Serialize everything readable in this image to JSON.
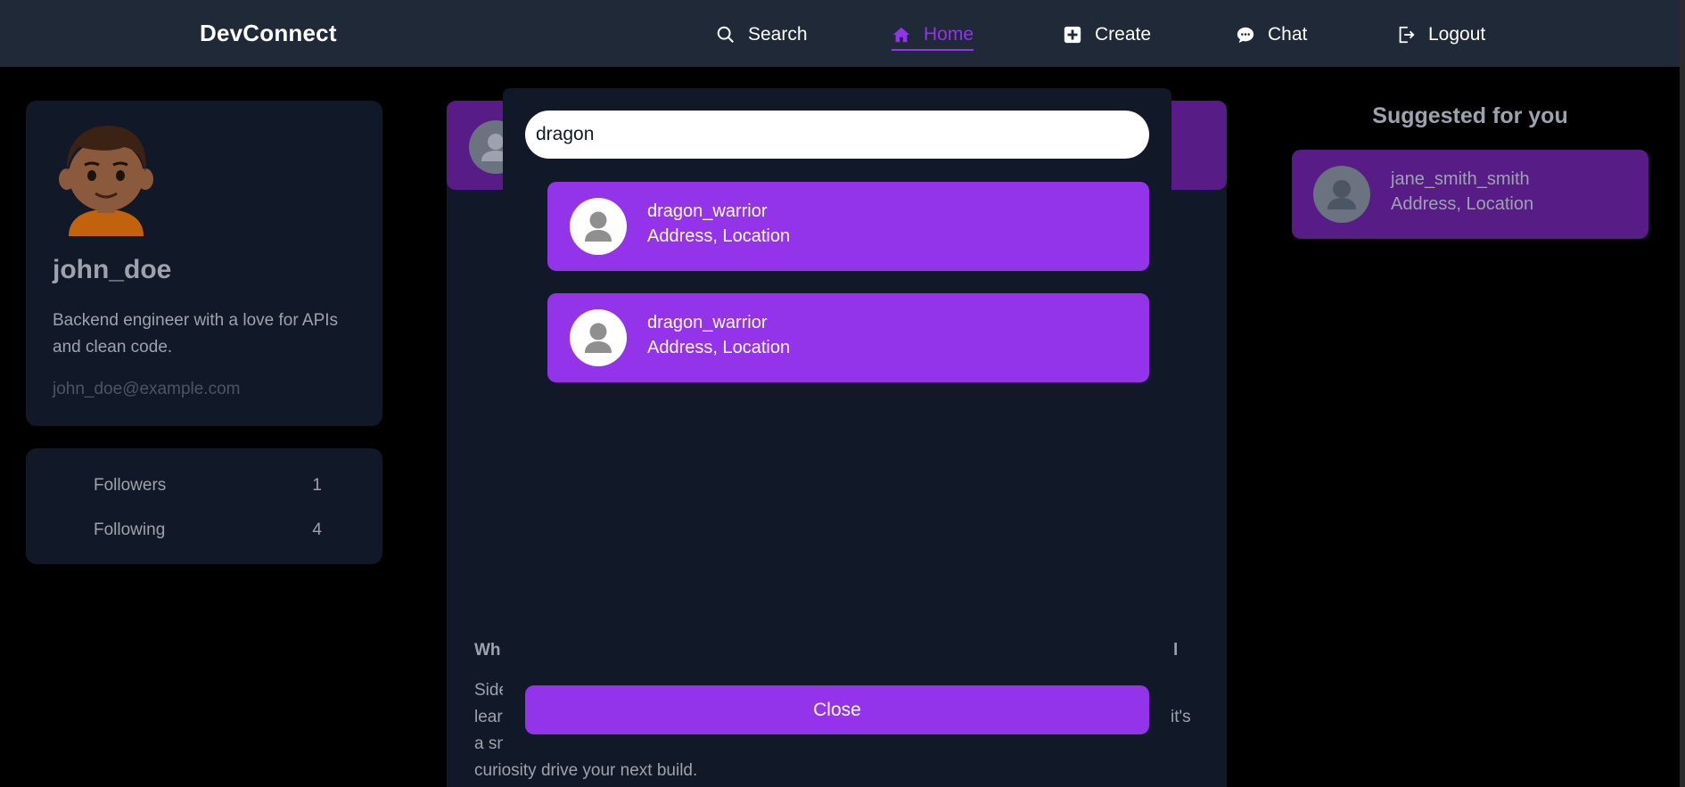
{
  "navbar": {
    "brand": "DevConnect",
    "items": [
      {
        "label": "Search",
        "icon": "search-icon"
      },
      {
        "label": "Home",
        "icon": "home-icon",
        "active": true
      },
      {
        "label": "Create",
        "icon": "plus-square-icon"
      },
      {
        "label": "Chat",
        "icon": "chat-bubble-icon"
      },
      {
        "label": "Logout",
        "icon": "logout-icon"
      }
    ]
  },
  "profile": {
    "username": "john_doe",
    "bio": "Backend engineer with a love for APIs and clean code.",
    "email": "john_doe@example.com",
    "stats": [
      {
        "label": "Followers",
        "value": "1"
      },
      {
        "label": "Following",
        "value": "4"
      }
    ]
  },
  "feed": {
    "title_start": "Wh",
    "title_end": "l",
    "text_lines": [
      "Side",
      "lear",
      "a sn",
      "curiosity drive your next build."
    ],
    "text_right": "it's"
  },
  "suggested": {
    "title": "Suggested for you",
    "users": [
      {
        "username": "jane_smith_smith",
        "location": "Address, Location"
      }
    ]
  },
  "search_modal": {
    "query": "dragon",
    "results": [
      {
        "username": "dragon_warrior",
        "location": "Address, Location"
      },
      {
        "username": "dragon_warrior",
        "location": "Address, Location"
      }
    ],
    "close_label": "Close"
  },
  "colors": {
    "accent": "#9333ea",
    "navbar_bg": "#1f2937",
    "card_bg": "#111827",
    "page_bg": "#000000"
  }
}
